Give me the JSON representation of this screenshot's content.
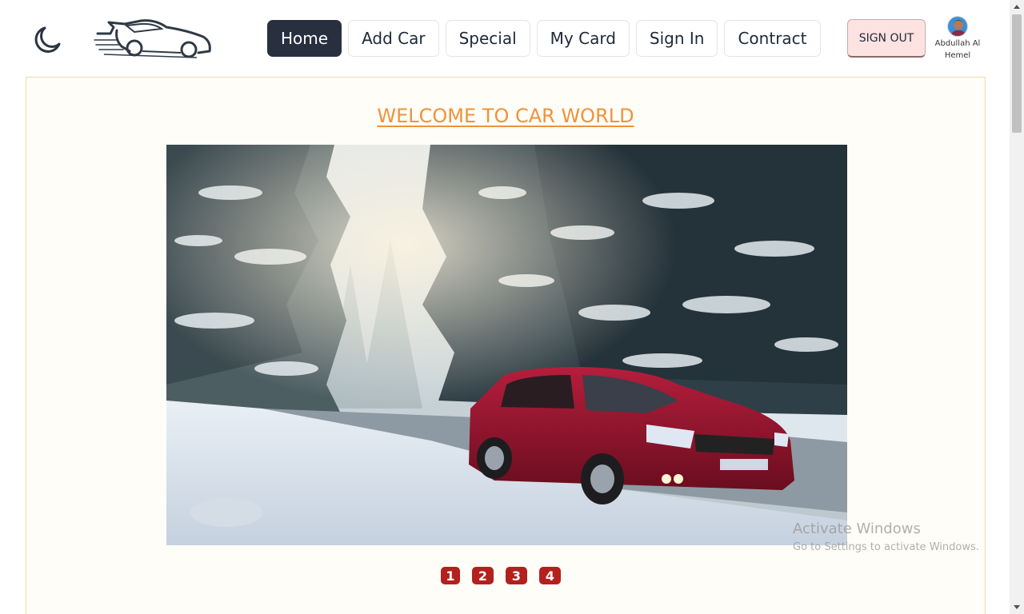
{
  "header": {
    "nav": [
      "Home",
      "Add Car",
      "Special",
      "My Card",
      "Sign In",
      "Contract"
    ],
    "active_index": 0,
    "signout_label": "SIGN OUT",
    "user_name": "Abdullah Al Hemel"
  },
  "main": {
    "title": "WELCOME TO CAR WORLD",
    "carousel_pages": [
      "1",
      "2",
      "3",
      "4"
    ]
  },
  "watermark": {
    "line1": "Activate Windows",
    "line2": "Go to Settings to activate Windows."
  },
  "colors": {
    "accent_title": "#f0923a",
    "nav_active": "#283040",
    "pagination": "#b3201e",
    "signout_bg": "#fde2e2"
  },
  "icons": {
    "theme_toggle": "moon-icon",
    "logo": "car-logo-icon"
  }
}
